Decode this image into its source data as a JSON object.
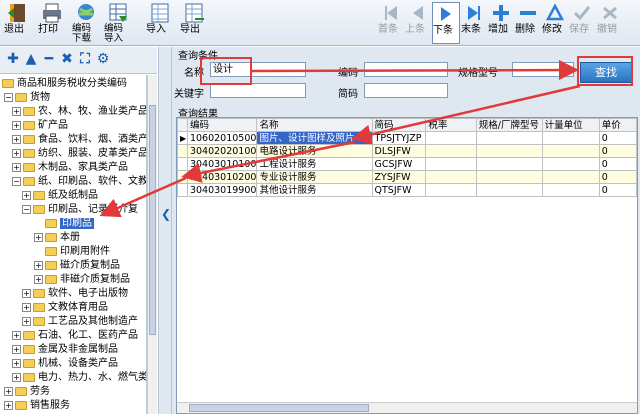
{
  "toolbar": {
    "exit": "退出",
    "print": "打印",
    "code_download": "编码\n下载",
    "code_import": "编码\n导入",
    "import": "导入",
    "export": "导出",
    "first": "首条",
    "prev": "上条",
    "next": "下条",
    "last": "末条",
    "add": "增加",
    "delete": "删除",
    "modify": "修改",
    "save": "保存",
    "cancel": "撤销"
  },
  "tree": {
    "root": "商品和服务税收分类编码",
    "items": [
      "货物",
      "农、林、牧、渔业类产品",
      "矿产品",
      "食品、饮料、烟、酒类产品",
      "纺织、服装、皮革类产品",
      "木制品、家具类产品",
      "纸、印刷品、软件、文教",
      "纸及纸制品",
      "印刷品、记录媒介复",
      "印刷品",
      "本册",
      "印刷用附件",
      "磁介质复制品",
      "非磁介质复制品",
      "软件、电子出版物",
      "文教体育用品",
      "工艺品及其他制造产",
      "石油、化工、医药产品",
      "金属及非金属制品",
      "机械、设备类产品",
      "电力、热力、水、燃气类",
      "劳务",
      "销售服务"
    ]
  },
  "query": {
    "group_title": "查询条件",
    "name_label": "名称",
    "name_value": "设计",
    "code_label": "编码",
    "spec_label": "规格型号",
    "keyword_label": "关键字",
    "short_label": "简码",
    "search_button": "查找"
  },
  "results": {
    "group_title": "查询结果",
    "columns": [
      "编码",
      "名称",
      "简码",
      "税率",
      "规格/厂牌型号",
      "计量单位",
      "单价"
    ],
    "rows": [
      {
        "code": "10602010500",
        "name": "图片、设计图样及照片",
        "short": "TPSJTYJZP",
        "price": "0"
      },
      {
        "code": "30402020100",
        "name": "电路设计服务",
        "short": "DLSJFW",
        "price": "0"
      },
      {
        "code": "30403010100",
        "name": "工程设计服务",
        "short": "GCSJFW",
        "price": "0"
      },
      {
        "code": "30403010200",
        "name": "专业设计服务",
        "short": "ZYSJFW",
        "price": "0"
      },
      {
        "code": "30403019900",
        "name": "其他设计服务",
        "short": "QTSJFW",
        "price": "0"
      }
    ]
  }
}
